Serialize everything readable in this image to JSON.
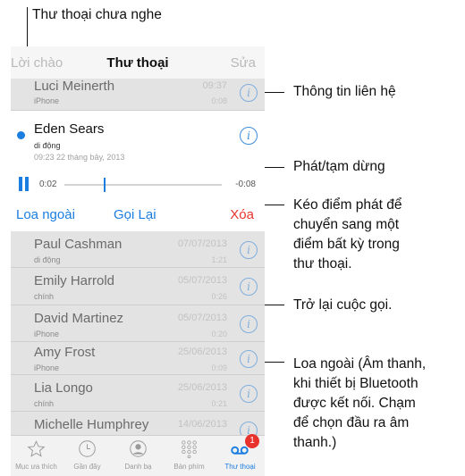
{
  "annotations": {
    "unheard": "Thư thoại chưa nghe",
    "contact_info": "Thông tin liên hệ",
    "play_pause": "Phát/tạm dừng",
    "scrub": [
      "Kéo điểm phát để",
      "chuyển sang một",
      "điểm bất kỳ trong",
      "thư thoại."
    ],
    "call_back": "Trở lại cuộc gọi.",
    "speaker": [
      "Loa ngoài (Âm thanh,",
      "khi thiết bị Bluetooth",
      "được kết nối. Chạm",
      "để chọn đầu ra âm",
      "thanh.)"
    ]
  },
  "nav": {
    "left": "Lời chào",
    "title": "Thư thoại",
    "right": "Sửa"
  },
  "selected": {
    "name": "Eden Sears",
    "type": "di động",
    "datetime": "09:23 22 tháng bảy, 2013",
    "elapsed": "0:02",
    "remaining": "-0:08",
    "speaker_label": "Loa ngoài",
    "callback_label": "Gọi Lại",
    "delete_label": "Xóa",
    "progress": 0.23
  },
  "voicemails": [
    {
      "name": "Luci Meinerth",
      "type": "iPhone",
      "date": "09:37",
      "duration": "0:08"
    },
    {
      "name": "Paul Cashman",
      "type": "di động",
      "date": "07/07/2013",
      "duration": "1:21"
    },
    {
      "name": "Emily Harrold",
      "type": "chính",
      "date": "05/07/2013",
      "duration": "0:26"
    },
    {
      "name": "David Martinez",
      "type": "iPhone",
      "date": "05/07/2013",
      "duration": "0:20"
    },
    {
      "name": "Amy Frost",
      "type": "iPhone",
      "date": "25/06/2013",
      "duration": "0:09"
    },
    {
      "name": "Lia Longo",
      "type": "chính",
      "date": "25/06/2013",
      "duration": "0:21"
    },
    {
      "name": "Michelle Humphrey",
      "date": "14/06/2013"
    }
  ],
  "tabs": [
    {
      "label": "Mục ưa thích",
      "icon": "star-icon"
    },
    {
      "label": "Gần đây",
      "icon": "clock-icon"
    },
    {
      "label": "Danh bạ",
      "icon": "contacts-icon"
    },
    {
      "label": "Bàn phím",
      "icon": "keypad-icon"
    },
    {
      "label": "Thư thoại",
      "icon": "voicemail-icon",
      "badge": "1"
    }
  ],
  "colors": {
    "accent": "#1b7de0",
    "delete": "#e8332c",
    "dimmed_row": "#e3e3e3"
  }
}
